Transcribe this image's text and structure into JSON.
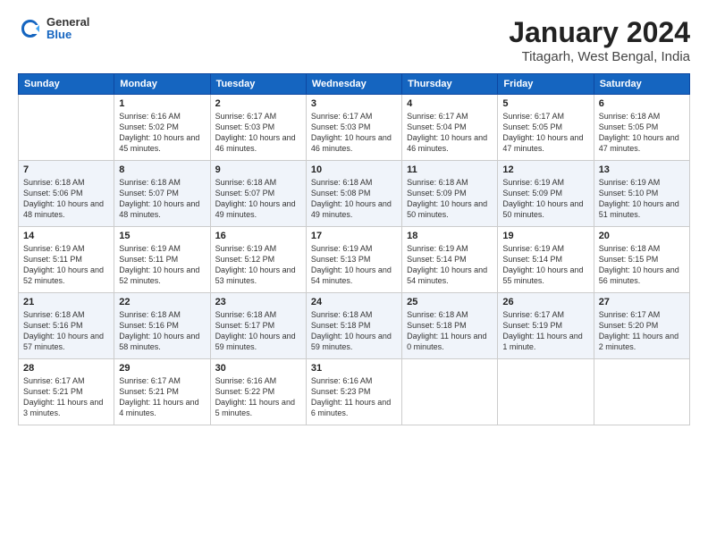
{
  "header": {
    "logo": {
      "general": "General",
      "blue": "Blue"
    },
    "title": "January 2024",
    "location": "Titagarh, West Bengal, India"
  },
  "weekdays": [
    "Sunday",
    "Monday",
    "Tuesday",
    "Wednesday",
    "Thursday",
    "Friday",
    "Saturday"
  ],
  "weeks": [
    [
      {
        "day": "",
        "sunrise": "",
        "sunset": "",
        "daylight": ""
      },
      {
        "day": "1",
        "sunrise": "Sunrise: 6:16 AM",
        "sunset": "Sunset: 5:02 PM",
        "daylight": "Daylight: 10 hours and 45 minutes."
      },
      {
        "day": "2",
        "sunrise": "Sunrise: 6:17 AM",
        "sunset": "Sunset: 5:03 PM",
        "daylight": "Daylight: 10 hours and 46 minutes."
      },
      {
        "day": "3",
        "sunrise": "Sunrise: 6:17 AM",
        "sunset": "Sunset: 5:03 PM",
        "daylight": "Daylight: 10 hours and 46 minutes."
      },
      {
        "day": "4",
        "sunrise": "Sunrise: 6:17 AM",
        "sunset": "Sunset: 5:04 PM",
        "daylight": "Daylight: 10 hours and 46 minutes."
      },
      {
        "day": "5",
        "sunrise": "Sunrise: 6:17 AM",
        "sunset": "Sunset: 5:05 PM",
        "daylight": "Daylight: 10 hours and 47 minutes."
      },
      {
        "day": "6",
        "sunrise": "Sunrise: 6:18 AM",
        "sunset": "Sunset: 5:05 PM",
        "daylight": "Daylight: 10 hours and 47 minutes."
      }
    ],
    [
      {
        "day": "7",
        "sunrise": "Sunrise: 6:18 AM",
        "sunset": "Sunset: 5:06 PM",
        "daylight": "Daylight: 10 hours and 48 minutes."
      },
      {
        "day": "8",
        "sunrise": "Sunrise: 6:18 AM",
        "sunset": "Sunset: 5:07 PM",
        "daylight": "Daylight: 10 hours and 48 minutes."
      },
      {
        "day": "9",
        "sunrise": "Sunrise: 6:18 AM",
        "sunset": "Sunset: 5:07 PM",
        "daylight": "Daylight: 10 hours and 49 minutes."
      },
      {
        "day": "10",
        "sunrise": "Sunrise: 6:18 AM",
        "sunset": "Sunset: 5:08 PM",
        "daylight": "Daylight: 10 hours and 49 minutes."
      },
      {
        "day": "11",
        "sunrise": "Sunrise: 6:18 AM",
        "sunset": "Sunset: 5:09 PM",
        "daylight": "Daylight: 10 hours and 50 minutes."
      },
      {
        "day": "12",
        "sunrise": "Sunrise: 6:19 AM",
        "sunset": "Sunset: 5:09 PM",
        "daylight": "Daylight: 10 hours and 50 minutes."
      },
      {
        "day": "13",
        "sunrise": "Sunrise: 6:19 AM",
        "sunset": "Sunset: 5:10 PM",
        "daylight": "Daylight: 10 hours and 51 minutes."
      }
    ],
    [
      {
        "day": "14",
        "sunrise": "Sunrise: 6:19 AM",
        "sunset": "Sunset: 5:11 PM",
        "daylight": "Daylight: 10 hours and 52 minutes."
      },
      {
        "day": "15",
        "sunrise": "Sunrise: 6:19 AM",
        "sunset": "Sunset: 5:11 PM",
        "daylight": "Daylight: 10 hours and 52 minutes."
      },
      {
        "day": "16",
        "sunrise": "Sunrise: 6:19 AM",
        "sunset": "Sunset: 5:12 PM",
        "daylight": "Daylight: 10 hours and 53 minutes."
      },
      {
        "day": "17",
        "sunrise": "Sunrise: 6:19 AM",
        "sunset": "Sunset: 5:13 PM",
        "daylight": "Daylight: 10 hours and 54 minutes."
      },
      {
        "day": "18",
        "sunrise": "Sunrise: 6:19 AM",
        "sunset": "Sunset: 5:14 PM",
        "daylight": "Daylight: 10 hours and 54 minutes."
      },
      {
        "day": "19",
        "sunrise": "Sunrise: 6:19 AM",
        "sunset": "Sunset: 5:14 PM",
        "daylight": "Daylight: 10 hours and 55 minutes."
      },
      {
        "day": "20",
        "sunrise": "Sunrise: 6:18 AM",
        "sunset": "Sunset: 5:15 PM",
        "daylight": "Daylight: 10 hours and 56 minutes."
      }
    ],
    [
      {
        "day": "21",
        "sunrise": "Sunrise: 6:18 AM",
        "sunset": "Sunset: 5:16 PM",
        "daylight": "Daylight: 10 hours and 57 minutes."
      },
      {
        "day": "22",
        "sunrise": "Sunrise: 6:18 AM",
        "sunset": "Sunset: 5:16 PM",
        "daylight": "Daylight: 10 hours and 58 minutes."
      },
      {
        "day": "23",
        "sunrise": "Sunrise: 6:18 AM",
        "sunset": "Sunset: 5:17 PM",
        "daylight": "Daylight: 10 hours and 59 minutes."
      },
      {
        "day": "24",
        "sunrise": "Sunrise: 6:18 AM",
        "sunset": "Sunset: 5:18 PM",
        "daylight": "Daylight: 10 hours and 59 minutes."
      },
      {
        "day": "25",
        "sunrise": "Sunrise: 6:18 AM",
        "sunset": "Sunset: 5:18 PM",
        "daylight": "Daylight: 11 hours and 0 minutes."
      },
      {
        "day": "26",
        "sunrise": "Sunrise: 6:17 AM",
        "sunset": "Sunset: 5:19 PM",
        "daylight": "Daylight: 11 hours and 1 minute."
      },
      {
        "day": "27",
        "sunrise": "Sunrise: 6:17 AM",
        "sunset": "Sunset: 5:20 PM",
        "daylight": "Daylight: 11 hours and 2 minutes."
      }
    ],
    [
      {
        "day": "28",
        "sunrise": "Sunrise: 6:17 AM",
        "sunset": "Sunset: 5:21 PM",
        "daylight": "Daylight: 11 hours and 3 minutes."
      },
      {
        "day": "29",
        "sunrise": "Sunrise: 6:17 AM",
        "sunset": "Sunset: 5:21 PM",
        "daylight": "Daylight: 11 hours and 4 minutes."
      },
      {
        "day": "30",
        "sunrise": "Sunrise: 6:16 AM",
        "sunset": "Sunset: 5:22 PM",
        "daylight": "Daylight: 11 hours and 5 minutes."
      },
      {
        "day": "31",
        "sunrise": "Sunrise: 6:16 AM",
        "sunset": "Sunset: 5:23 PM",
        "daylight": "Daylight: 11 hours and 6 minutes."
      },
      {
        "day": "",
        "sunrise": "",
        "sunset": "",
        "daylight": ""
      },
      {
        "day": "",
        "sunrise": "",
        "sunset": "",
        "daylight": ""
      },
      {
        "day": "",
        "sunrise": "",
        "sunset": "",
        "daylight": ""
      }
    ]
  ]
}
